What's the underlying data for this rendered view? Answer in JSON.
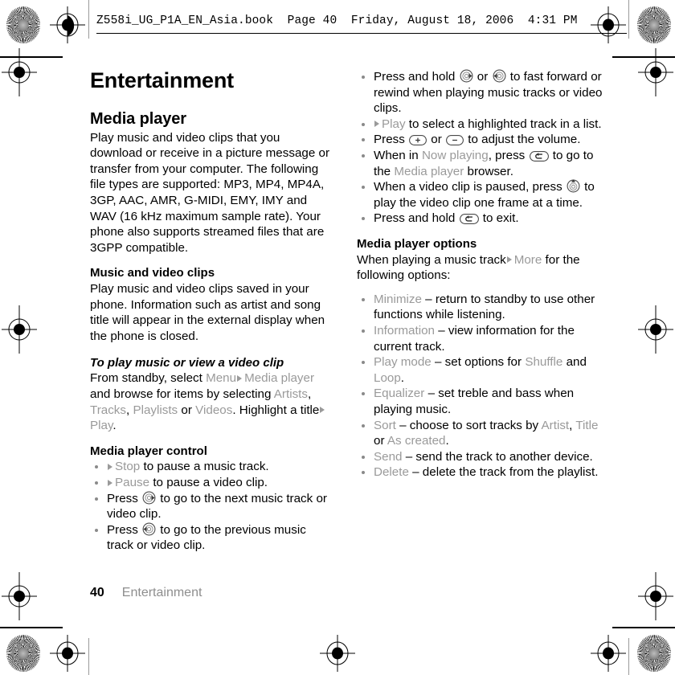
{
  "header": {
    "running_text": "Z558i_UG_P1A_EN_Asia.book  Page 40  Friday, August 18, 2006  4:31 PM"
  },
  "page": {
    "title": "Entertainment",
    "section_title": "Media player",
    "intro": "Play music and video clips that you download or receive in a picture message or transfer from your computer. The following file types are supported: MP3, MP4, MP4A, 3GP, AAC, AMR, G-MIDI, EMY, IMY and WAV (16 kHz maximum sample rate). Your phone also supports streamed files that are 3GPP compatible.",
    "music_video_heading": "Music and video clips",
    "music_video_body": "Play music and video clips saved in your phone. Information such as artist and song title will appear in the external display when the phone is closed.",
    "to_play_heading": "To play music or view a video clip",
    "to_play": {
      "p1": "From standby, select",
      "menu": "Menu",
      "media_player": "Media player",
      "p2": "and browse for items by selecting",
      "artists": "Artists",
      "tracks": "Tracks",
      "playlists": "Playlists",
      "or": "or",
      "videos": "Videos",
      "p3": ". Highlight a title",
      "play": "Play",
      "period": "."
    },
    "control_heading": "Media player control",
    "controls": {
      "stop_term": "Stop",
      "stop_rest": "to pause a music track.",
      "pause_term": "Pause",
      "pause_rest": "to pause a video clip.",
      "next_pre": "Press",
      "next_post": "to go to the next music track or video clip.",
      "prev_pre": "Press",
      "prev_post": "to go to the previous music track or video clip.",
      "ff_pre": "Press and hold",
      "ff_mid": "or",
      "ff_post": "to fast forward or rewind when playing music tracks or video clips.",
      "play_term": "Play",
      "play_rest": "to select a highlighted track in a list.",
      "vol_pre": "Press",
      "vol_mid": "or",
      "vol_post": "to adjust the volume.",
      "now_pre": "When in",
      "now_playing": "Now playing",
      "now_mid": ", press",
      "now_post": "to go to the",
      "now_browser_term": "Media player",
      "now_browser_rest": "browser.",
      "frame_pre": "When a video clip is paused, press",
      "frame_post": "to play the video clip one frame at a time.",
      "exit_pre": "Press and hold",
      "exit_post": "to exit."
    },
    "options_heading": "Media player options",
    "options_intro_pre": "When playing a music track",
    "options_intro_more": "More",
    "options_intro_post": "for the following options:",
    "options": [
      {
        "term": "Minimize",
        "rest": "– return to standby to use other functions while listening."
      },
      {
        "term": "Information",
        "rest": "– view information for the current track."
      },
      {
        "term": "Play mode",
        "rest": "– set options for",
        "term2": "Shuffle",
        "mid": "and",
        "term3": "Loop",
        "tail": "."
      },
      {
        "term": "Equalizer",
        "rest": "– set treble and bass when playing music."
      },
      {
        "term": "Sort",
        "rest": "– choose to sort tracks by",
        "term2": "Artist",
        "mid": ",",
        "term3": "Title",
        "mid2": "or",
        "term4": "As created",
        "tail": "."
      },
      {
        "term": "Send",
        "rest": "– send the track to another device."
      },
      {
        "term": "Delete",
        "rest": "– delete the track from the playlist."
      }
    ]
  },
  "footer": {
    "page_number": "40",
    "chapter": "Entertainment"
  },
  "colors": {
    "text": "#000000",
    "ui_term_grey": "#9a9a9a",
    "footer_grey": "#8e8e8e",
    "bullet_grey": "#8a8a8a"
  }
}
